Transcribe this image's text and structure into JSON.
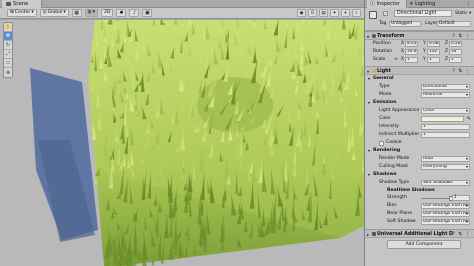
{
  "scene": {
    "tab_label": "Scene",
    "toolbar": {
      "pivot": "Center",
      "space": "Global",
      "mode_2d": "2D",
      "right_icons": [
        "audio-icon",
        "effects-icon",
        "hidden-icon",
        "camera-icon",
        "gizmo-icon",
        "search-icon"
      ],
      "right_label": "Gizmos"
    },
    "tools": [
      "hand-icon",
      "move-icon",
      "rotate-icon",
      "scale-icon",
      "rect-icon",
      "transform-icon"
    ],
    "selected_tool": "move-icon"
  },
  "inspector": {
    "tab_label": "Inspector",
    "second_tab": "Lighting",
    "object": {
      "name": "Directional Light",
      "static_label": "Static",
      "tag_label": "Tag",
      "tag_value": "Untagged",
      "layer_label": "Layer",
      "layer_value": "Default"
    },
    "transform": {
      "title": "Transform",
      "position": {
        "label": "Position",
        "x": "8.43",
        "y": "6.08",
        "z": "0.28"
      },
      "rotation": {
        "label": "Rotation",
        "x": "34.88",
        "y": "132",
        "z": "34"
      },
      "scale": {
        "label": "Scale",
        "x": "1",
        "y": "1",
        "z": "1"
      }
    },
    "light": {
      "title": "Light",
      "general": {
        "title": "General",
        "type_label": "Type",
        "type_value": "Directional",
        "mode_label": "Mode",
        "mode_value": "Realtime"
      },
      "emission": {
        "title": "Emission",
        "appearance_label": "Light Appearance",
        "appearance_value": "Color",
        "color_label": "Color",
        "color_hex": "#f2f0dc",
        "intensity_label": "Intensity",
        "intensity_value": "1",
        "indirect_label": "Indirect Multiplier",
        "indirect_value": "1",
        "cookie_label": "Cookie"
      },
      "rendering": {
        "title": "Rendering",
        "render_mode_label": "Render Mode",
        "render_mode_value": "Auto",
        "culling_label": "Culling Mask",
        "culling_value": "Everything"
      },
      "shadows": {
        "title": "Shadows",
        "shadow_type_label": "Shadow Type",
        "shadow_type_value": "Soft Shadows",
        "realtime_title": "Realtime Shadows",
        "strength_label": "Strength",
        "strength_value": "1",
        "strength_fraction": 1.0,
        "bias_label": "Bias",
        "bias_value": "Use settings from Ren",
        "near_plane_label": "Near Plane",
        "near_plane_value": "Use settings from Ren",
        "soft_shadow_label": "Soft Shadow",
        "soft_shadow_value": "Use settings from Ren"
      }
    },
    "ual_title": "Universal Additional Light D",
    "add_component": "Add Component"
  },
  "colors": {
    "grass_light": "#c7de70",
    "grass_mid": "#9fbd4c",
    "grass_dark": "#6c8f2c",
    "shadow_blue": "#5e74a0",
    "sky": "#b9b9b9"
  }
}
